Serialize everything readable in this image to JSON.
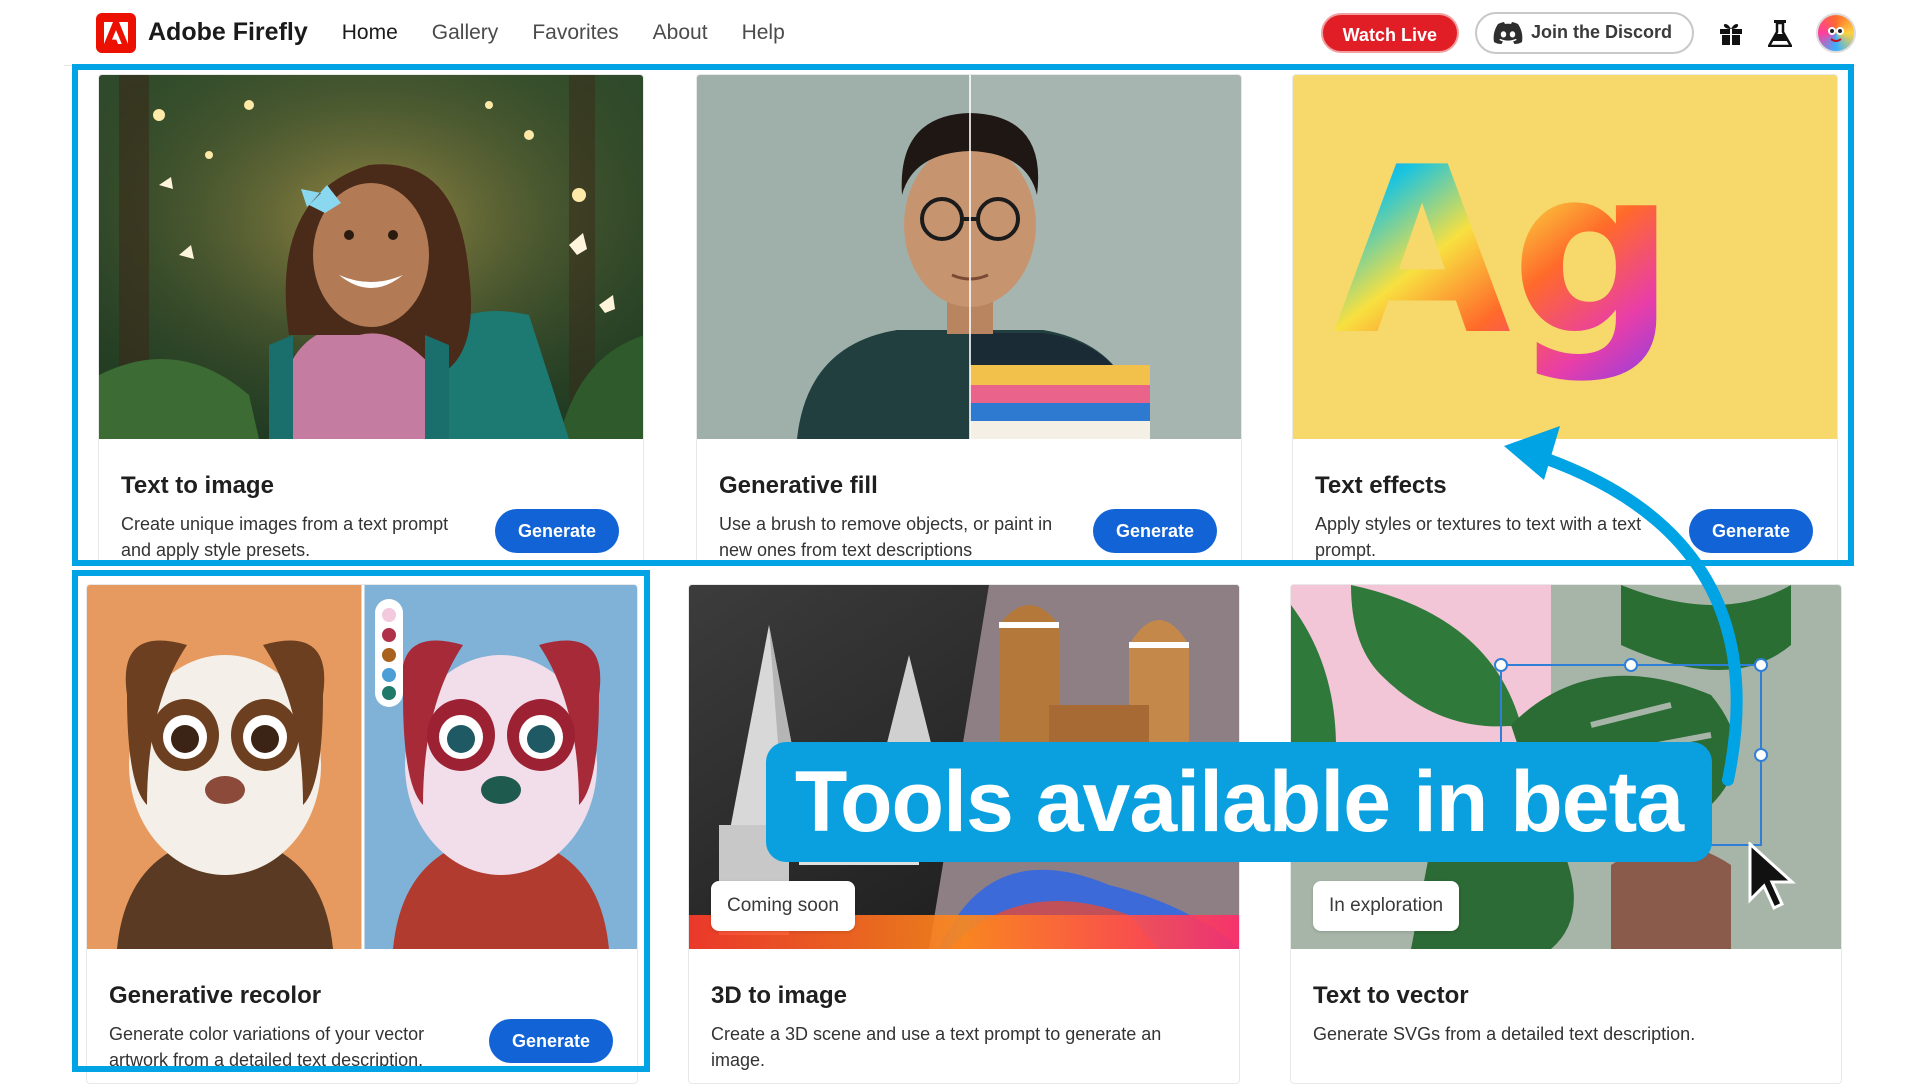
{
  "brand": {
    "name": "Adobe Firefly"
  },
  "nav": {
    "items": [
      "Home",
      "Gallery",
      "Favorites",
      "About",
      "Help"
    ]
  },
  "topbar": {
    "watch_live": "Watch Live",
    "discord": "Join the Discord"
  },
  "cards": [
    {
      "title": "Text to image",
      "desc": "Create unique images from a text prompt and apply style presets.",
      "button": "Generate"
    },
    {
      "title": "Generative fill",
      "desc": "Use a brush to remove objects, or paint in new ones from text descriptions",
      "button": "Generate"
    },
    {
      "title": "Text effects",
      "desc": "Apply styles or textures to text with a text prompt.",
      "button": "Generate",
      "media_text": "Ag"
    },
    {
      "title": "Generative recolor",
      "desc": "Generate color variations of your vector artwork from a detailed text description.",
      "button": "Generate"
    },
    {
      "title": "3D to image",
      "desc": "Create a 3D scene and use a text prompt to generate an image.",
      "status": "Coming soon"
    },
    {
      "title": "Text to vector",
      "desc": "Generate SVGs from a detailed text description.",
      "status": "In exploration"
    }
  ],
  "callout": {
    "text": "Tools available in beta"
  },
  "colors": {
    "highlight": "#00a4e4",
    "button": "#1163d6",
    "watch_live": "#e11d26",
    "brand": "#eb1000"
  }
}
